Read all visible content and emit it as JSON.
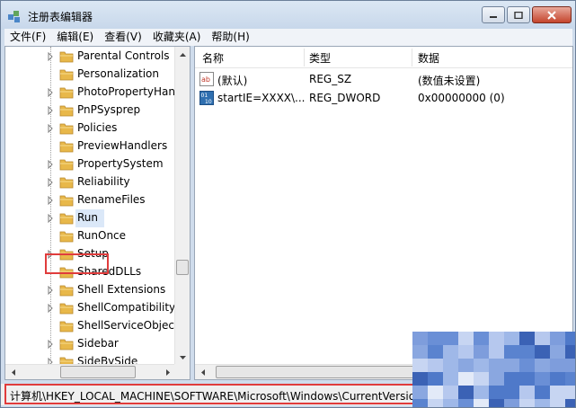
{
  "window": {
    "title": "注册表编辑器"
  },
  "menu": [
    "文件(F)",
    "编辑(E)",
    "查看(V)",
    "收藏夹(A)",
    "帮助(H)"
  ],
  "tree": {
    "items": [
      {
        "label": "Parental Controls",
        "expandable": true
      },
      {
        "label": "Personalization",
        "expandable": false
      },
      {
        "label": "PhotoPropertyHand",
        "expandable": true
      },
      {
        "label": "PnPSysprep",
        "expandable": true
      },
      {
        "label": "Policies",
        "expandable": true
      },
      {
        "label": "PreviewHandlers",
        "expandable": false
      },
      {
        "label": "PropertySystem",
        "expandable": true
      },
      {
        "label": "Reliability",
        "expandable": true
      },
      {
        "label": "RenameFiles",
        "expandable": true
      },
      {
        "label": "Run",
        "expandable": true
      },
      {
        "label": "RunOnce",
        "expandable": false
      },
      {
        "label": "Setup",
        "expandable": true
      },
      {
        "label": "SharedDLLs",
        "expandable": false
      },
      {
        "label": "Shell Extensions",
        "expandable": true
      },
      {
        "label": "ShellCompatibility",
        "expandable": true
      },
      {
        "label": "ShellServiceObjectD",
        "expandable": false
      },
      {
        "label": "Sidebar",
        "expandable": true
      },
      {
        "label": "SideBySide",
        "expandable": true
      }
    ],
    "selected": "Run"
  },
  "list": {
    "columns": [
      "名称",
      "类型",
      "数据"
    ],
    "rows": [
      {
        "icon": "string-value-icon",
        "name": "(默认)",
        "type": "REG_SZ",
        "data": "(数值未设置)"
      },
      {
        "icon": "dword-value-icon",
        "name": "startIE=XXXX\\...",
        "type": "REG_DWORD",
        "data": "0x00000000 (0)"
      }
    ]
  },
  "status": {
    "path": "计算机\\HKEY_LOCAL_MACHINE\\SOFTWARE\\Microsoft\\Windows\\CurrentVersion\\Run"
  },
  "colors": {
    "highlight_border": "#e03c3c",
    "folder": "#e8b84a",
    "title_bg": "#cfdcec"
  }
}
